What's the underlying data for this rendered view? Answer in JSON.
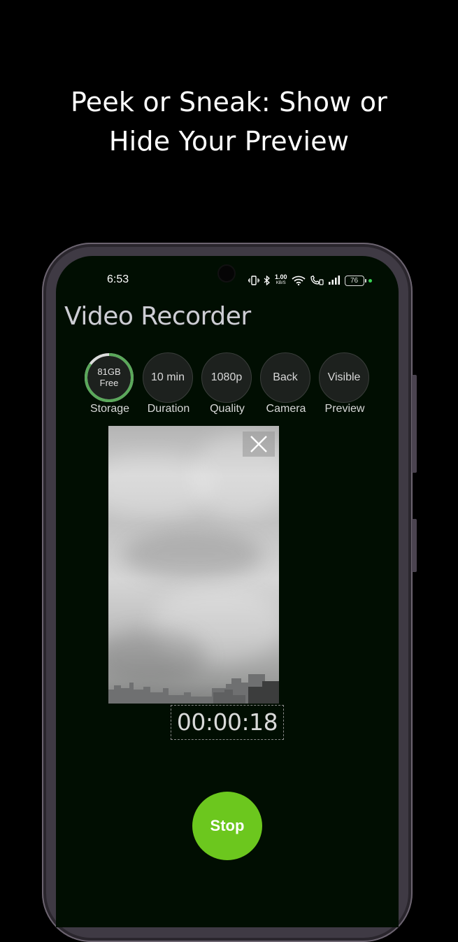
{
  "headline": {
    "line1": "Peek or Sneak: Show or",
    "line2": "Hide Your Preview"
  },
  "status_bar": {
    "time": "6:53",
    "net_speed": "1.00",
    "net_speed_unit": "KB/S",
    "battery": "76",
    "icons": [
      "vibrate-icon",
      "bluetooth-icon",
      "wifi-icon",
      "volte-call-icon",
      "signal-icon",
      "battery-icon"
    ]
  },
  "app": {
    "title": "Video Recorder"
  },
  "settings": [
    {
      "value_line1": "81GB",
      "value_line2": "Free",
      "label": "Storage",
      "fill_fraction": 0.85
    },
    {
      "value": "10 min",
      "label": "Duration"
    },
    {
      "value": "1080p",
      "label": "Quality"
    },
    {
      "value": "Back",
      "label": "Camera"
    },
    {
      "value": "Visible",
      "label": "Preview"
    }
  ],
  "timer": "00:00:18",
  "stop_label": "Stop",
  "colors": {
    "background": "#000000",
    "screen": "#010e02",
    "accent_green": "#6cc71e",
    "storage_ring": "#5aa85a"
  }
}
